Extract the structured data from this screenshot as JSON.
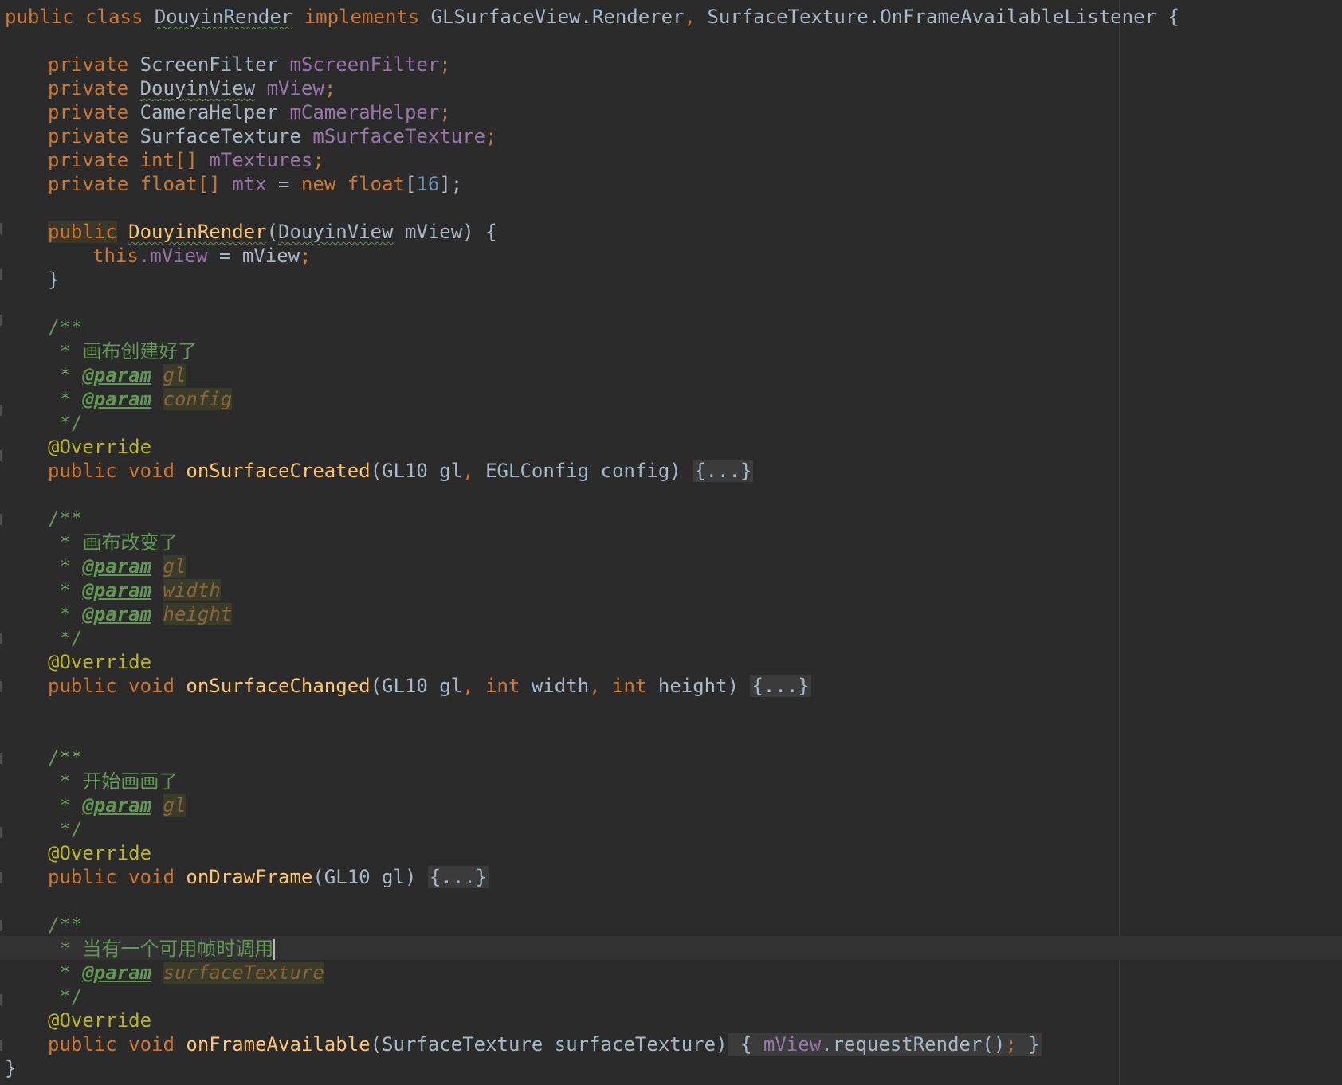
{
  "code": {
    "class_decl": {
      "kw1": "public",
      "kw2": "class",
      "name": "DouyinRender",
      "kw3": "implements",
      "iface1": "GLSurfaceView.Renderer",
      "comma": ",",
      "iface2": "SurfaceTexture.OnFrameAvailableListener",
      "brace": "{"
    },
    "fields": [
      {
        "mod": "private",
        "type": "ScreenFilter",
        "name": "mScreenFilter"
      },
      {
        "mod": "private",
        "type": "DouyinView",
        "name": "mView"
      },
      {
        "mod": "private",
        "type": "CameraHelper",
        "name": "mCameraHelper"
      },
      {
        "mod": "private",
        "type": "SurfaceTexture",
        "name": "mSurfaceTexture"
      },
      {
        "mod": "private",
        "type": "int[]",
        "name": "mTextures"
      },
      {
        "mod": "private",
        "type": "float[]",
        "name": "mtx"
      }
    ],
    "mtx_init": {
      "eq": "=",
      "kw": "new",
      "type": "float",
      "open": "[",
      "num": "16",
      "close": "];"
    },
    "semicolon": ";",
    "constructor": {
      "mod": "public",
      "name": "DouyinRender",
      "param_type": "DouyinView",
      "param_name": "mView",
      "this_kw": "this",
      "field": ".mView",
      "assign": " = mView",
      "end": ";",
      "close": "}"
    },
    "doc_open": "/**",
    "doc_star": "*",
    "doc_close": "*/",
    "param_tag": "@param",
    "override": "@Override",
    "fold": "{...}",
    "methods": [
      {
        "comment": "画布创建好了",
        "params": [
          "gl",
          "config"
        ],
        "mod": "public",
        "ret": "void",
        "name": "onSurfaceCreated",
        "sig_a": "(GL10 gl",
        "sig_b": " EGLConfig config)"
      },
      {
        "comment": "画布改变了",
        "params": [
          "gl",
          "width",
          "height"
        ],
        "mod": "public",
        "ret": "void",
        "name": "onSurfaceChanged",
        "sig_a": "(GL10 gl",
        "int_kw": "int",
        "sig_b": " width",
        "sig_c": " height)"
      },
      {
        "comment": "开始画画了",
        "params": [
          "gl"
        ],
        "mod": "public",
        "ret": "void",
        "name": "onDrawFrame",
        "sig_a": "(GL10 gl)"
      },
      {
        "comment": "当有一个可用帧时调用",
        "params": [
          "surfaceTexture"
        ],
        "mod": "public",
        "ret": "void",
        "name": "onFrameAvailable",
        "sig_a": "(SurfaceTexture surfaceTexture)",
        "body_open": "{",
        "body_field": "mView",
        "body_call": ".requestRender()",
        "body_end": ";",
        "body_close": "}"
      }
    ],
    "class_close": "}"
  }
}
